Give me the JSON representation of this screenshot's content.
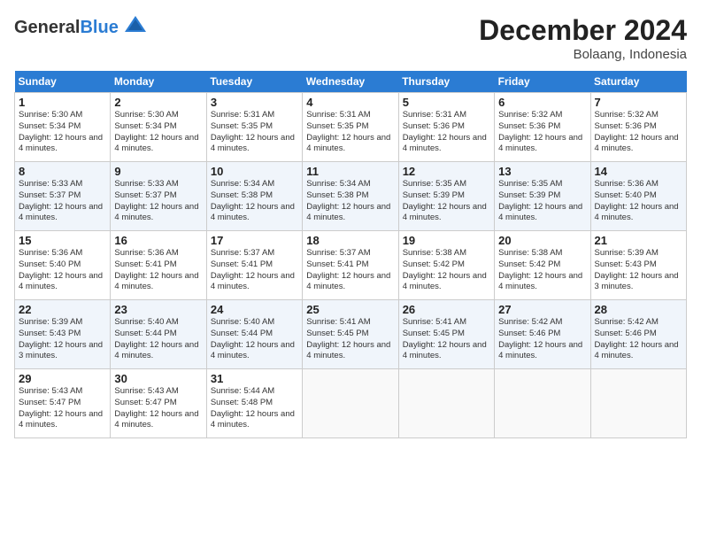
{
  "header": {
    "logo_general": "General",
    "logo_blue": "Blue",
    "month": "December 2024",
    "location": "Bolaang, Indonesia"
  },
  "days_of_week": [
    "Sunday",
    "Monday",
    "Tuesday",
    "Wednesday",
    "Thursday",
    "Friday",
    "Saturday"
  ],
  "weeks": [
    [
      {
        "day": 1,
        "sunrise": "5:30 AM",
        "sunset": "5:34 PM",
        "daylight": "12 hours and 4 minutes."
      },
      {
        "day": 2,
        "sunrise": "5:30 AM",
        "sunset": "5:34 PM",
        "daylight": "12 hours and 4 minutes."
      },
      {
        "day": 3,
        "sunrise": "5:31 AM",
        "sunset": "5:35 PM",
        "daylight": "12 hours and 4 minutes."
      },
      {
        "day": 4,
        "sunrise": "5:31 AM",
        "sunset": "5:35 PM",
        "daylight": "12 hours and 4 minutes."
      },
      {
        "day": 5,
        "sunrise": "5:31 AM",
        "sunset": "5:36 PM",
        "daylight": "12 hours and 4 minutes."
      },
      {
        "day": 6,
        "sunrise": "5:32 AM",
        "sunset": "5:36 PM",
        "daylight": "12 hours and 4 minutes."
      },
      {
        "day": 7,
        "sunrise": "5:32 AM",
        "sunset": "5:36 PM",
        "daylight": "12 hours and 4 minutes."
      }
    ],
    [
      {
        "day": 8,
        "sunrise": "5:33 AM",
        "sunset": "5:37 PM",
        "daylight": "12 hours and 4 minutes."
      },
      {
        "day": 9,
        "sunrise": "5:33 AM",
        "sunset": "5:37 PM",
        "daylight": "12 hours and 4 minutes."
      },
      {
        "day": 10,
        "sunrise": "5:34 AM",
        "sunset": "5:38 PM",
        "daylight": "12 hours and 4 minutes."
      },
      {
        "day": 11,
        "sunrise": "5:34 AM",
        "sunset": "5:38 PM",
        "daylight": "12 hours and 4 minutes."
      },
      {
        "day": 12,
        "sunrise": "5:35 AM",
        "sunset": "5:39 PM",
        "daylight": "12 hours and 4 minutes."
      },
      {
        "day": 13,
        "sunrise": "5:35 AM",
        "sunset": "5:39 PM",
        "daylight": "12 hours and 4 minutes."
      },
      {
        "day": 14,
        "sunrise": "5:36 AM",
        "sunset": "5:40 PM",
        "daylight": "12 hours and 4 minutes."
      }
    ],
    [
      {
        "day": 15,
        "sunrise": "5:36 AM",
        "sunset": "5:40 PM",
        "daylight": "12 hours and 4 minutes."
      },
      {
        "day": 16,
        "sunrise": "5:36 AM",
        "sunset": "5:41 PM",
        "daylight": "12 hours and 4 minutes."
      },
      {
        "day": 17,
        "sunrise": "5:37 AM",
        "sunset": "5:41 PM",
        "daylight": "12 hours and 4 minutes."
      },
      {
        "day": 18,
        "sunrise": "5:37 AM",
        "sunset": "5:41 PM",
        "daylight": "12 hours and 4 minutes."
      },
      {
        "day": 19,
        "sunrise": "5:38 AM",
        "sunset": "5:42 PM",
        "daylight": "12 hours and 4 minutes."
      },
      {
        "day": 20,
        "sunrise": "5:38 AM",
        "sunset": "5:42 PM",
        "daylight": "12 hours and 4 minutes."
      },
      {
        "day": 21,
        "sunrise": "5:39 AM",
        "sunset": "5:43 PM",
        "daylight": "12 hours and 3 minutes."
      }
    ],
    [
      {
        "day": 22,
        "sunrise": "5:39 AM",
        "sunset": "5:43 PM",
        "daylight": "12 hours and 3 minutes."
      },
      {
        "day": 23,
        "sunrise": "5:40 AM",
        "sunset": "5:44 PM",
        "daylight": "12 hours and 4 minutes."
      },
      {
        "day": 24,
        "sunrise": "5:40 AM",
        "sunset": "5:44 PM",
        "daylight": "12 hours and 4 minutes."
      },
      {
        "day": 25,
        "sunrise": "5:41 AM",
        "sunset": "5:45 PM",
        "daylight": "12 hours and 4 minutes."
      },
      {
        "day": 26,
        "sunrise": "5:41 AM",
        "sunset": "5:45 PM",
        "daylight": "12 hours and 4 minutes."
      },
      {
        "day": 27,
        "sunrise": "5:42 AM",
        "sunset": "5:46 PM",
        "daylight": "12 hours and 4 minutes."
      },
      {
        "day": 28,
        "sunrise": "5:42 AM",
        "sunset": "5:46 PM",
        "daylight": "12 hours and 4 minutes."
      }
    ],
    [
      {
        "day": 29,
        "sunrise": "5:43 AM",
        "sunset": "5:47 PM",
        "daylight": "12 hours and 4 minutes."
      },
      {
        "day": 30,
        "sunrise": "5:43 AM",
        "sunset": "5:47 PM",
        "daylight": "12 hours and 4 minutes."
      },
      {
        "day": 31,
        "sunrise": "5:44 AM",
        "sunset": "5:48 PM",
        "daylight": "12 hours and 4 minutes."
      },
      null,
      null,
      null,
      null
    ]
  ]
}
